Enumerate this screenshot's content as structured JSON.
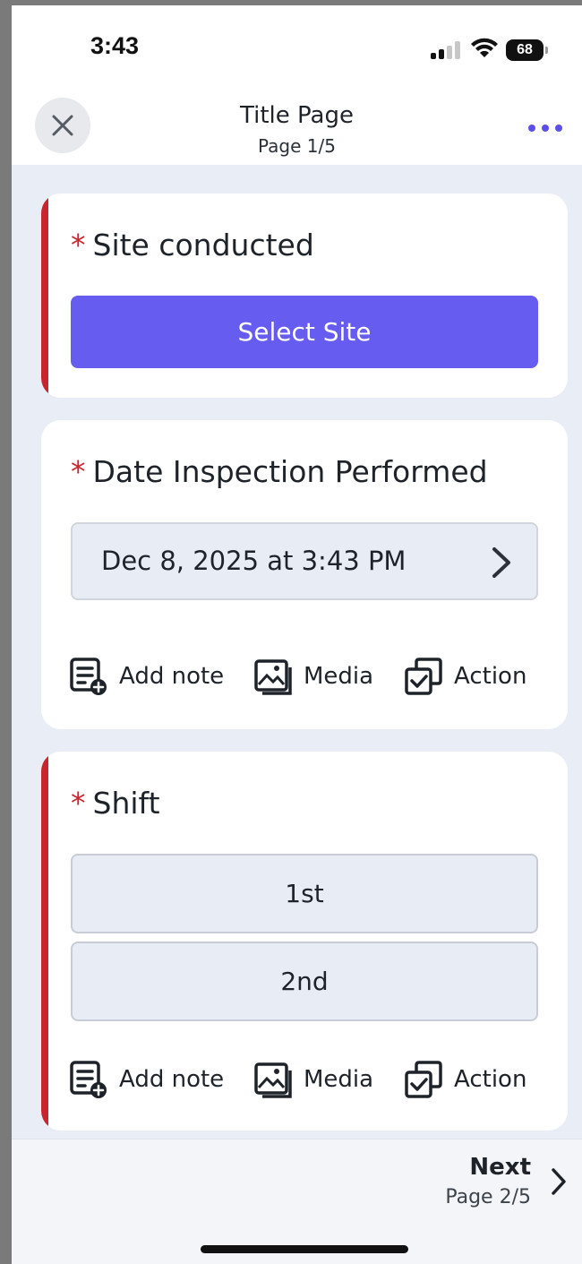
{
  "status_bar": {
    "time": "3:43",
    "battery": "68"
  },
  "header": {
    "title": "Title Page",
    "subtitle": "Page 1/5"
  },
  "questions": [
    {
      "star": "*",
      "label": "Site conducted",
      "button": "Select Site"
    },
    {
      "star": "*",
      "label": "Date Inspection Performed",
      "value": "Dec 8, 2025 at 3:43 PM"
    },
    {
      "star": "*",
      "label": "Shift",
      "options": [
        "1st",
        "2nd"
      ]
    }
  ],
  "actions": {
    "note": "Add note",
    "media": "Media",
    "action": "Action"
  },
  "footer": {
    "next": "Next",
    "next_page": "Page 2/5"
  },
  "colors": {
    "accent": "#675cf0",
    "required": "#c9252d",
    "background": "#e9edf5"
  }
}
